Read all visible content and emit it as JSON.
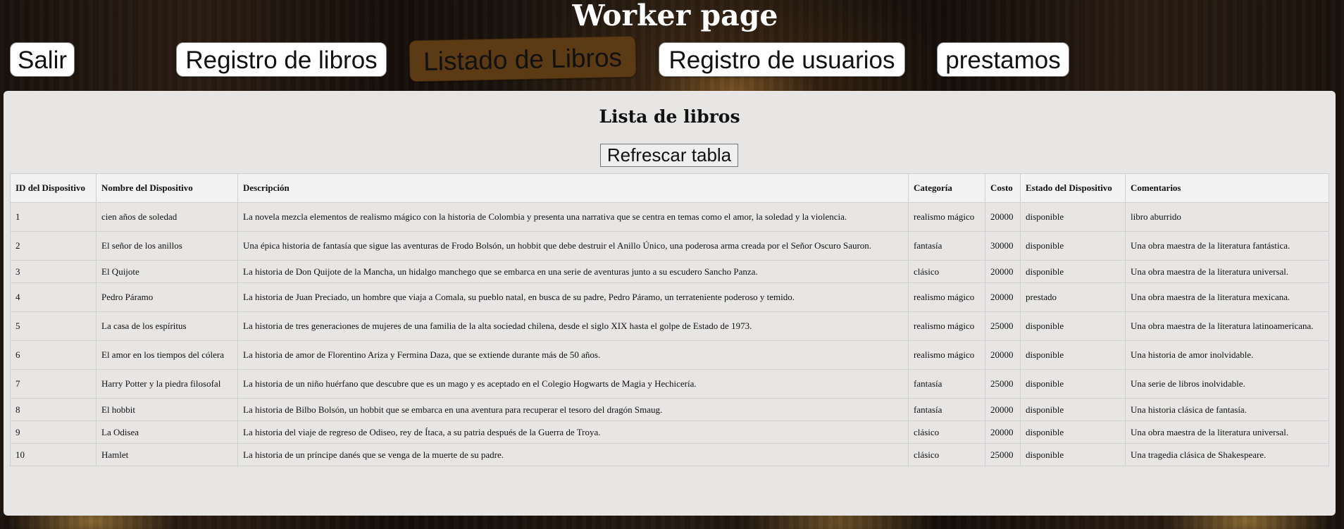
{
  "header": {
    "title": "Worker page"
  },
  "nav": {
    "salir": "Salir",
    "registro_libros": "Registro de libros",
    "listado_libros": "Listado de Libros",
    "registro_usuarios": "Registro de usuarios",
    "prestamos": "prestamos"
  },
  "panel": {
    "title": "Lista de libros",
    "refresh_label": "Refrescar tabla"
  },
  "table": {
    "headers": [
      "ID del Dispositivo",
      "Nombre del Dispositivo",
      "Descripción",
      "Categoría",
      "Costo",
      "Estado del Dispositivo",
      "Comentarios"
    ],
    "rows": [
      [
        "1",
        "cien años de soledad",
        "La novela mezcla elementos de realismo mágico con la historia de Colombia y presenta una narrativa que se centra en temas como el amor, la soledad y la violencia.",
        "realismo mágico",
        "20000",
        "disponible",
        "libro aburrido"
      ],
      [
        "2",
        "El señor de los anillos",
        "Una épica historia de fantasía que sigue las aventuras de Frodo Bolsón, un hobbit que debe destruir el Anillo Único, una poderosa arma creada por el Señor Oscuro Sauron.",
        "fantasía",
        "30000",
        "disponible",
        "Una obra maestra de la literatura fantástica."
      ],
      [
        "3",
        "El Quijote",
        "La historia de Don Quijote de la Mancha, un hidalgo manchego que se embarca en una serie de aventuras junto a su escudero Sancho Panza.",
        "clásico",
        "20000",
        "disponible",
        "Una obra maestra de la literatura universal."
      ],
      [
        "4",
        "Pedro Páramo",
        "La historia de Juan Preciado, un hombre que viaja a Comala, su pueblo natal, en busca de su padre, Pedro Páramo, un terrateniente poderoso y temido.",
        "realismo mágico",
        "20000",
        "prestado",
        "Una obra maestra de la literatura mexicana."
      ],
      [
        "5",
        "La casa de los espíritus",
        "La historia de tres generaciones de mujeres de una familia de la alta sociedad chilena, desde el siglo XIX hasta el golpe de Estado de 1973.",
        "realismo mágico",
        "25000",
        "disponible",
        "Una obra maestra de la literatura latinoamericana."
      ],
      [
        "6",
        "El amor en los tiempos del cólera",
        "La historia de amor de Florentino Ariza y Fermina Daza, que se extiende durante más de 50 años.",
        "realismo mágico",
        "20000",
        "disponible",
        "Una historia de amor inolvidable."
      ],
      [
        "7",
        "Harry Potter y la piedra filosofal",
        "La historia de un niño huérfano que descubre que es un mago y es aceptado en el Colegio Hogwarts de Magia y Hechicería.",
        "fantasía",
        "25000",
        "disponible",
        "Una serie de libros inolvidable."
      ],
      [
        "8",
        "El hobbit",
        "La historia de Bilbo Bolsón, un hobbit que se embarca en una aventura para recuperar el tesoro del dragón Smaug.",
        "fantasía",
        "20000",
        "disponible",
        "Una historia clásica de fantasía."
      ],
      [
        "9",
        "La Odisea",
        "La historia del viaje de regreso de Odiseo, rey de Ítaca, a su patria después de la Guerra de Troya.",
        "clásico",
        "20000",
        "disponible",
        "Una obra maestra de la literatura universal."
      ],
      [
        "10",
        "Hamlet",
        "La historia de un príncipe danés que se venga de la muerte de su padre.",
        "clásico",
        "25000",
        "disponible",
        "Una tragedia clásica de Shakespeare."
      ]
    ]
  }
}
